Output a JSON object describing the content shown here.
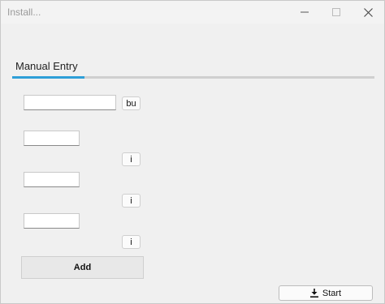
{
  "window": {
    "title": "Install..."
  },
  "tabs": [
    {
      "label": "Manual Entry",
      "selected": true
    }
  ],
  "tab_indicator": {
    "progress_fraction": 0.2
  },
  "form": {
    "row1": {
      "value": "",
      "button_label": "bu"
    },
    "row2": {
      "value": "",
      "button_label": "i"
    },
    "row3": {
      "value": "",
      "button_label": "i"
    },
    "row4": {
      "value": "",
      "button_label": "i"
    }
  },
  "actions": {
    "add_label": "Add",
    "start_label": "Start"
  },
  "icons": {
    "minimize": "minimize-icon",
    "maximize": "maximize-icon",
    "close": "close-icon",
    "start": "download-icon"
  },
  "colors": {
    "accent": "#2e9fd8",
    "background": "#f0f0f0"
  }
}
